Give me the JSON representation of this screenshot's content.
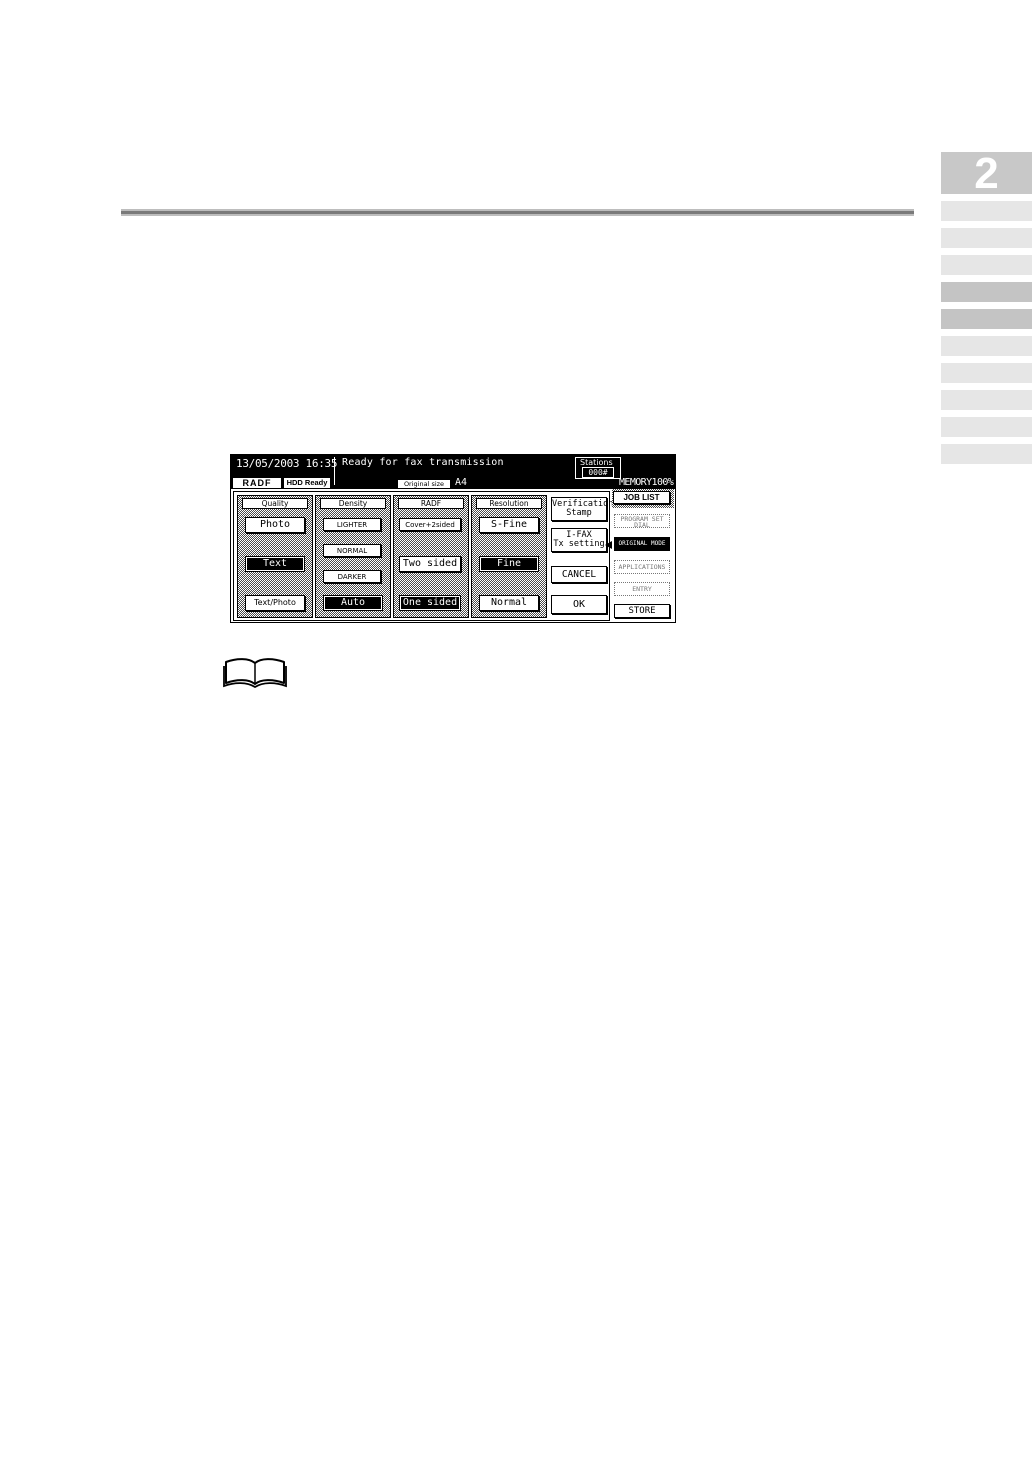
{
  "chapter": {
    "number": "2"
  },
  "side_tabs": [
    {
      "shade": "light"
    },
    {
      "shade": "light"
    },
    {
      "shade": "light"
    },
    {
      "shade": "dark"
    },
    {
      "shade": "dark"
    },
    {
      "shade": "light"
    },
    {
      "shade": "light"
    },
    {
      "shade": "light"
    },
    {
      "shade": "light"
    },
    {
      "shade": "light"
    }
  ],
  "panel": {
    "datetime": "13/05/2003 16:35",
    "status": "Ready for fax transmission",
    "stations_label": "Stations",
    "stations_count": "000#",
    "radf_badge": "RADF",
    "hdd_badge": "HDD Ready",
    "original_size_label": "Original size",
    "original_size_value": "A4",
    "memory": "MEMORY100%",
    "columns": {
      "quality": {
        "header": "Quality",
        "buttons": [
          {
            "label": "Photo",
            "selected": false
          },
          {
            "label": "Text",
            "selected": true
          },
          {
            "label": "Text/Photo",
            "selected": false
          }
        ]
      },
      "density": {
        "header": "Density",
        "buttons": [
          {
            "label": "LIGHTER",
            "selected": false
          },
          {
            "label": "NORMAL",
            "selected": false
          },
          {
            "label": "DARKER",
            "selected": false
          },
          {
            "label": "Auto",
            "selected": true
          }
        ]
      },
      "radf": {
        "header": "RADF",
        "buttons": [
          {
            "label": "Cover+2sided",
            "selected": false
          },
          {
            "label": "Two sided",
            "selected": false
          },
          {
            "label": "One sided",
            "selected": true
          }
        ]
      },
      "resolution": {
        "header": "Resolution",
        "buttons": [
          {
            "label": "S-Fine",
            "selected": false
          },
          {
            "label": "Fine",
            "selected": true
          },
          {
            "label": "Normal",
            "selected": false
          }
        ]
      }
    },
    "side_buttons": {
      "verification_line1": "Verification",
      "verification_line2": "Stamp",
      "ifax_line1": "I-FAX",
      "ifax_line2": "Tx setting",
      "cancel": "CANCEL",
      "ok": "OK"
    },
    "right_buttons": {
      "job_list": "JOB LIST",
      "program_line1": "PROGRAM SET",
      "program_line2": "DIAL",
      "original_mode": "ORIGINAL MODE",
      "applications": "APPLICATIONS",
      "entry": "ENTRY",
      "store": "STORE"
    }
  }
}
